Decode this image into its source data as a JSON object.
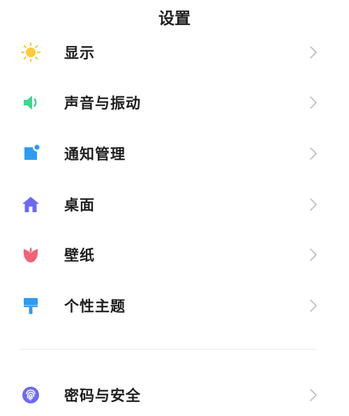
{
  "header": {
    "title": "设置"
  },
  "settings": {
    "items": [
      {
        "label": "显示",
        "icon": "sun-icon",
        "color": "#FFC93C"
      },
      {
        "label": "声音与振动",
        "icon": "speaker-icon",
        "color": "#3DD68C"
      },
      {
        "label": "通知管理",
        "icon": "notification-icon",
        "color": "#2F9BF0"
      },
      {
        "label": "桌面",
        "icon": "home-icon",
        "color": "#6E6AF0"
      },
      {
        "label": "壁纸",
        "icon": "tulip-icon",
        "color": "#F0637A"
      },
      {
        "label": "个性主题",
        "icon": "paint-brush-icon",
        "color": "#2F9BF0"
      }
    ],
    "security": {
      "label": "密码与安全",
      "icon": "fingerprint-icon",
      "color": "#6E6AF0"
    }
  },
  "colors": {
    "background": "#FFFFFF",
    "text": "#1E1E1E",
    "chevron": "#BDBDBD",
    "divider": "#ECECEC"
  }
}
